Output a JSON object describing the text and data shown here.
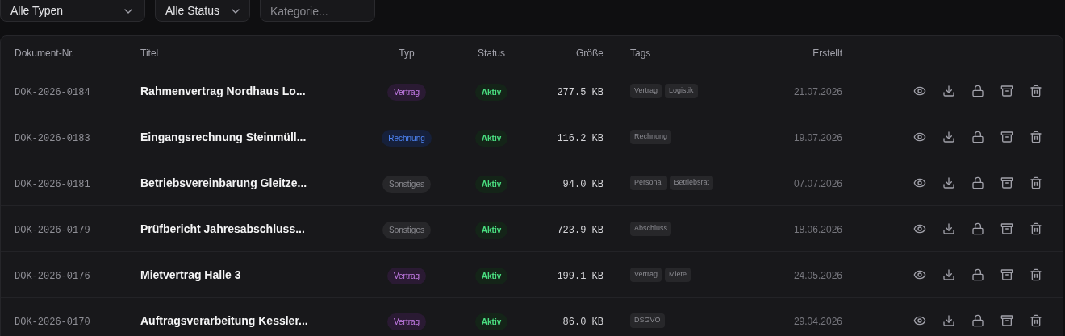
{
  "filters": [
    {
      "kind": "select",
      "value": "Alle Typen"
    },
    {
      "kind": "select",
      "value": "Alle Status"
    },
    {
      "kind": "input",
      "placeholder": "Kategorie..."
    }
  ],
  "table": {
    "columns": [
      "Dokument-Nr.",
      "Titel",
      "Typ",
      "Status",
      "Größe",
      "Tags",
      "Erstellt"
    ],
    "rows": [
      {
        "number": "DOK-2026-0184",
        "title": "Rahmenvertrag Nordhaus Lo...",
        "type": {
          "kind": "vertrag",
          "label": "Vertrag"
        },
        "status": {
          "kind": "aktiv",
          "label": "Aktiv"
        },
        "size": "277.5 KB",
        "tags": [
          "Vertrag",
          "Logistik"
        ],
        "created": "21.07.2026"
      },
      {
        "number": "DOK-2026-0183",
        "title": "Eingangsrechnung Steinmüll...",
        "type": {
          "kind": "rechnung",
          "label": "Rechnung"
        },
        "status": {
          "kind": "aktiv",
          "label": "Aktiv"
        },
        "size": "116.2 KB",
        "tags": [
          "Rechnung"
        ],
        "created": "19.07.2026"
      },
      {
        "number": "DOK-2026-0181",
        "title": "Betriebsvereinbarung Gleitze...",
        "type": {
          "kind": "sonstiges",
          "label": "Sonstiges"
        },
        "status": {
          "kind": "aktiv",
          "label": "Aktiv"
        },
        "size": "94.0 KB",
        "tags": [
          "Personal",
          "Betriebsrat"
        ],
        "created": "07.07.2026"
      },
      {
        "number": "DOK-2026-0179",
        "title": "Prüfbericht Jahresabschluss...",
        "type": {
          "kind": "sonstiges",
          "label": "Sonstiges"
        },
        "status": {
          "kind": "aktiv",
          "label": "Aktiv"
        },
        "size": "723.9 KB",
        "tags": [
          "Abschluss"
        ],
        "created": "18.06.2026"
      },
      {
        "number": "DOK-2026-0176",
        "title": "Mietvertrag Halle 3",
        "type": {
          "kind": "vertrag",
          "label": "Vertrag"
        },
        "status": {
          "kind": "aktiv",
          "label": "Aktiv"
        },
        "size": "199.1 KB",
        "tags": [
          "Vertrag",
          "Miete"
        ],
        "created": "24.05.2026"
      },
      {
        "number": "DOK-2026-0170",
        "title": "Auftragsverarbeitung Kessler...",
        "type": {
          "kind": "vertrag",
          "label": "Vertrag"
        },
        "status": {
          "kind": "aktiv",
          "label": "Aktiv"
        },
        "size": "86.0 KB",
        "tags": [
          "DSGVO"
        ],
        "created": "29.04.2026"
      }
    ]
  }
}
